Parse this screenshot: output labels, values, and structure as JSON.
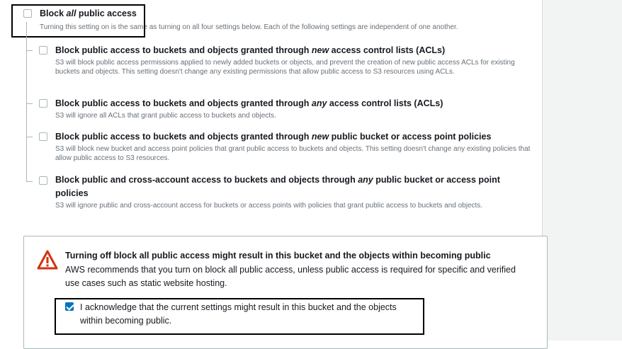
{
  "block_all": {
    "label_pre": "Block ",
    "label_em": "all",
    "label_post": " public access",
    "description": "Turning this setting on is the same as turning on all four settings below. Each of the following settings are independent of one another."
  },
  "options": [
    {
      "title_pre": "Block public access to buckets and objects granted through ",
      "title_em": "new",
      "title_post": " access control lists (ACLs)",
      "description": "S3 will block public access permissions applied to newly added buckets or objects, and prevent the creation of new public access ACLs for existing buckets and objects. This setting doesn't change any existing permissions that allow public access to S3 resources using ACLs."
    },
    {
      "title_pre": "Block public access to buckets and objects granted through ",
      "title_em": "any",
      "title_post": " access control lists (ACLs)",
      "description": "S3 will ignore all ACLs that grant public access to buckets and objects."
    },
    {
      "title_pre": "Block public access to buckets and objects granted through ",
      "title_em": "new",
      "title_post": " public bucket or access point policies",
      "description": "S3 will block new bucket and access point policies that grant public access to buckets and objects. This setting doesn't change any existing policies that allow public access to S3 resources."
    },
    {
      "title_pre": "Block public and cross-account access to buckets and objects through ",
      "title_em": "any",
      "title_post": " public bucket or access point",
      "title_line2": "policies",
      "description": "S3 will ignore public and cross-account access for buckets or access points with policies that grant public access to buckets and objects."
    }
  ],
  "warning": {
    "title": "Turning off block all public access might result in this bucket and the objects within becoming public",
    "description": "AWS recommends that you turn on block all public access, unless public access is required for specific and verified use cases such as static website hosting.",
    "acknowledge_label": "I acknowledge that the current settings might result in this bucket and the objects within becoming public.",
    "acknowledge_checked": true
  },
  "colors": {
    "accent": "#0073bb",
    "warning": "#d13212",
    "muted_text": "#687078"
  }
}
